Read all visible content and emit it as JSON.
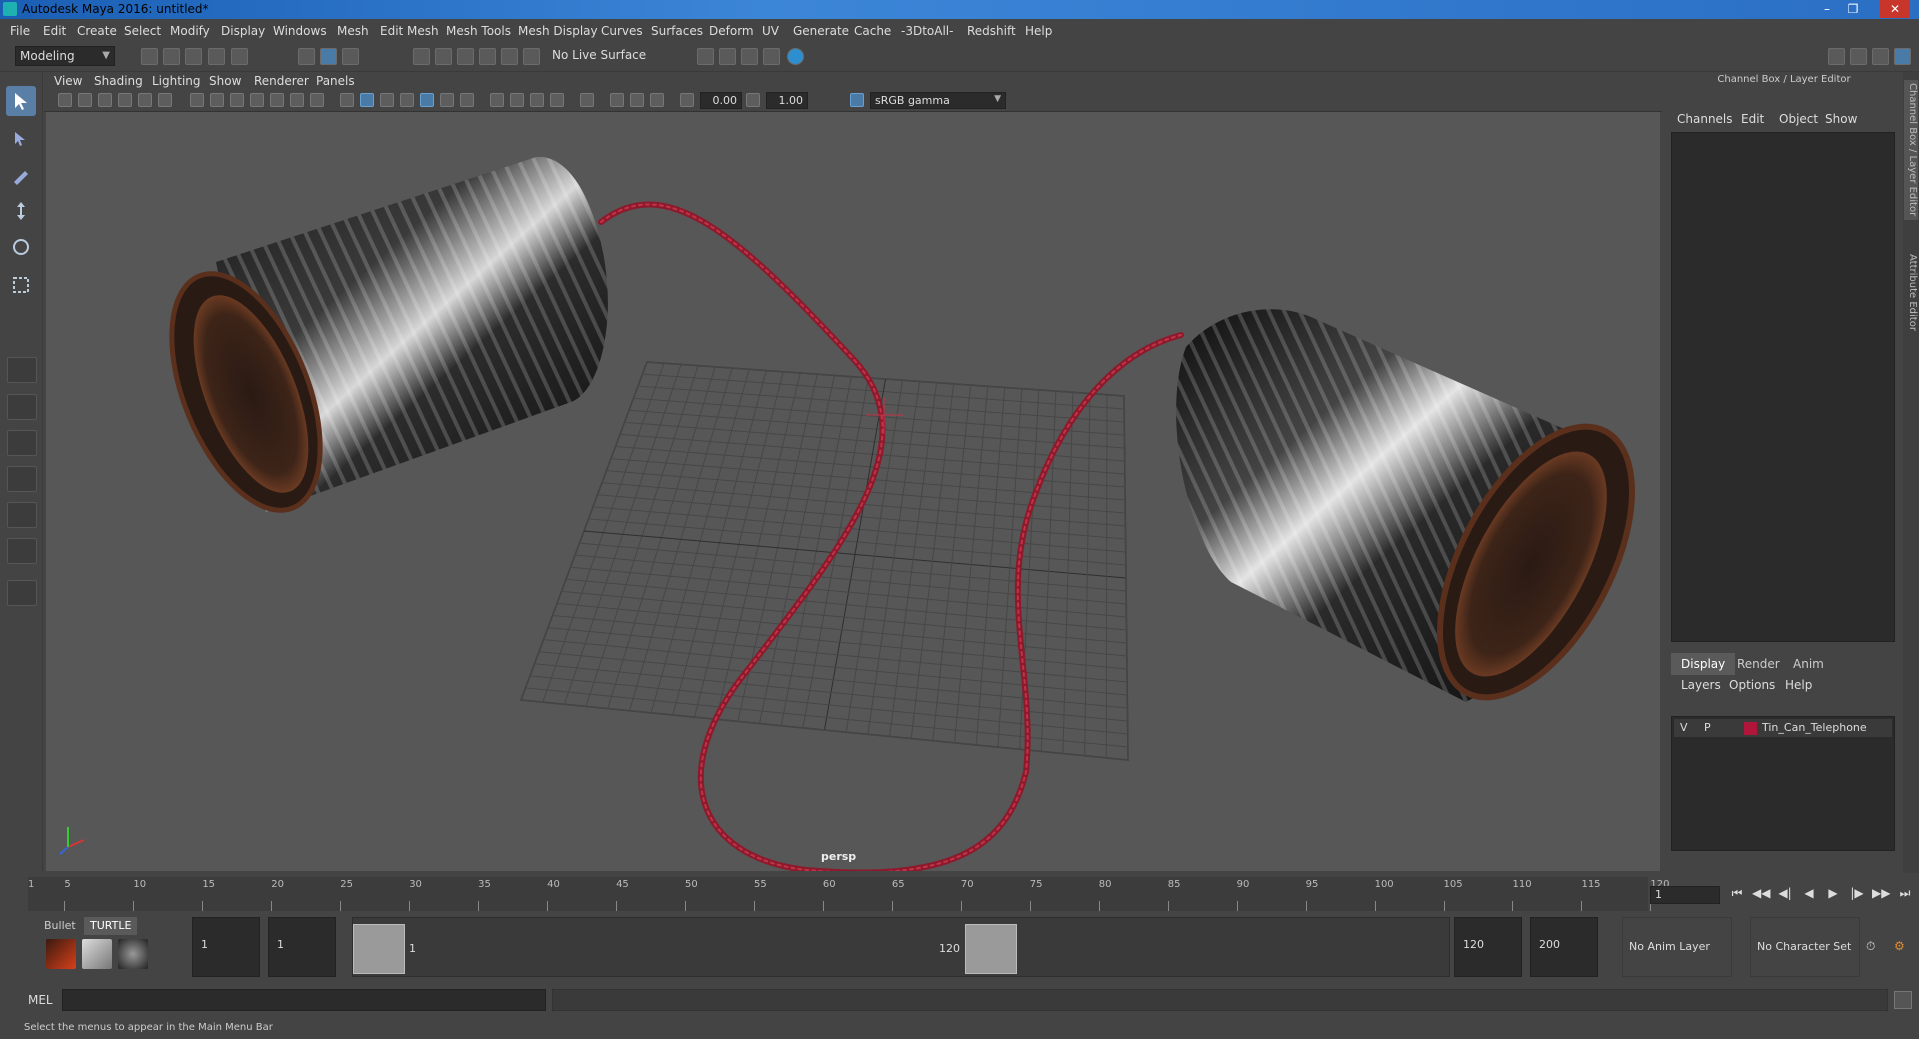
{
  "title_bar": {
    "title": "Autodesk Maya 2016: untitled*"
  },
  "menu": [
    "File",
    "Edit",
    "Create",
    "Select",
    "Modify",
    "Display",
    "Windows",
    "Mesh",
    "Edit Mesh",
    "Mesh Tools",
    "Mesh Display",
    "Curves",
    "Surfaces",
    "Deform",
    "UV",
    "Generate",
    "Cache",
    "-3DtoAll-",
    "Redshift",
    "Help"
  ],
  "shelf": {
    "mode": "Modeling",
    "live_surface": "No Live Surface"
  },
  "viewport": {
    "menu": [
      "View",
      "Shading",
      "Lighting",
      "Show",
      "Renderer",
      "Panels"
    ],
    "field_a": "0.00",
    "field_b": "1.00",
    "color_space": "sRGB gamma",
    "camera": "persp"
  },
  "channel_box": {
    "title": "Channel Box / Layer Editor",
    "tabs": [
      "Channels",
      "Edit",
      "Object",
      "Show"
    ],
    "layer_tabs": [
      "Display",
      "Render",
      "Anim"
    ],
    "layer_menu": [
      "Layers",
      "Options",
      "Help"
    ],
    "layers": [
      {
        "v": "V",
        "p": "P",
        "name": "Tin_Can_Telephone",
        "color": "#b0163a"
      }
    ]
  },
  "side_tabs": [
    "Channel Box / Layer Editor",
    "Attribute Editor"
  ],
  "timeline": {
    "ticks": [
      "5",
      "10",
      "15",
      "20",
      "25",
      "30",
      "35",
      "40",
      "45",
      "50",
      "55",
      "60",
      "65",
      "70",
      "75",
      "80",
      "85",
      "90",
      "95",
      "100",
      "105",
      "110",
      "115",
      "120"
    ],
    "start_label": "1",
    "current_frame": "1"
  },
  "range": {
    "shelf_tabs": [
      "Bullet",
      "TURTLE"
    ],
    "start": "1",
    "playback_start": "1",
    "slider_start": "1",
    "slider_end": "120",
    "playback_end": "120",
    "end": "200",
    "anim_layer": "No Anim Layer",
    "character_set": "No Character Set"
  },
  "command_line": {
    "label": "MEL"
  },
  "status": "Select the menus to appear in the Main Menu Bar"
}
